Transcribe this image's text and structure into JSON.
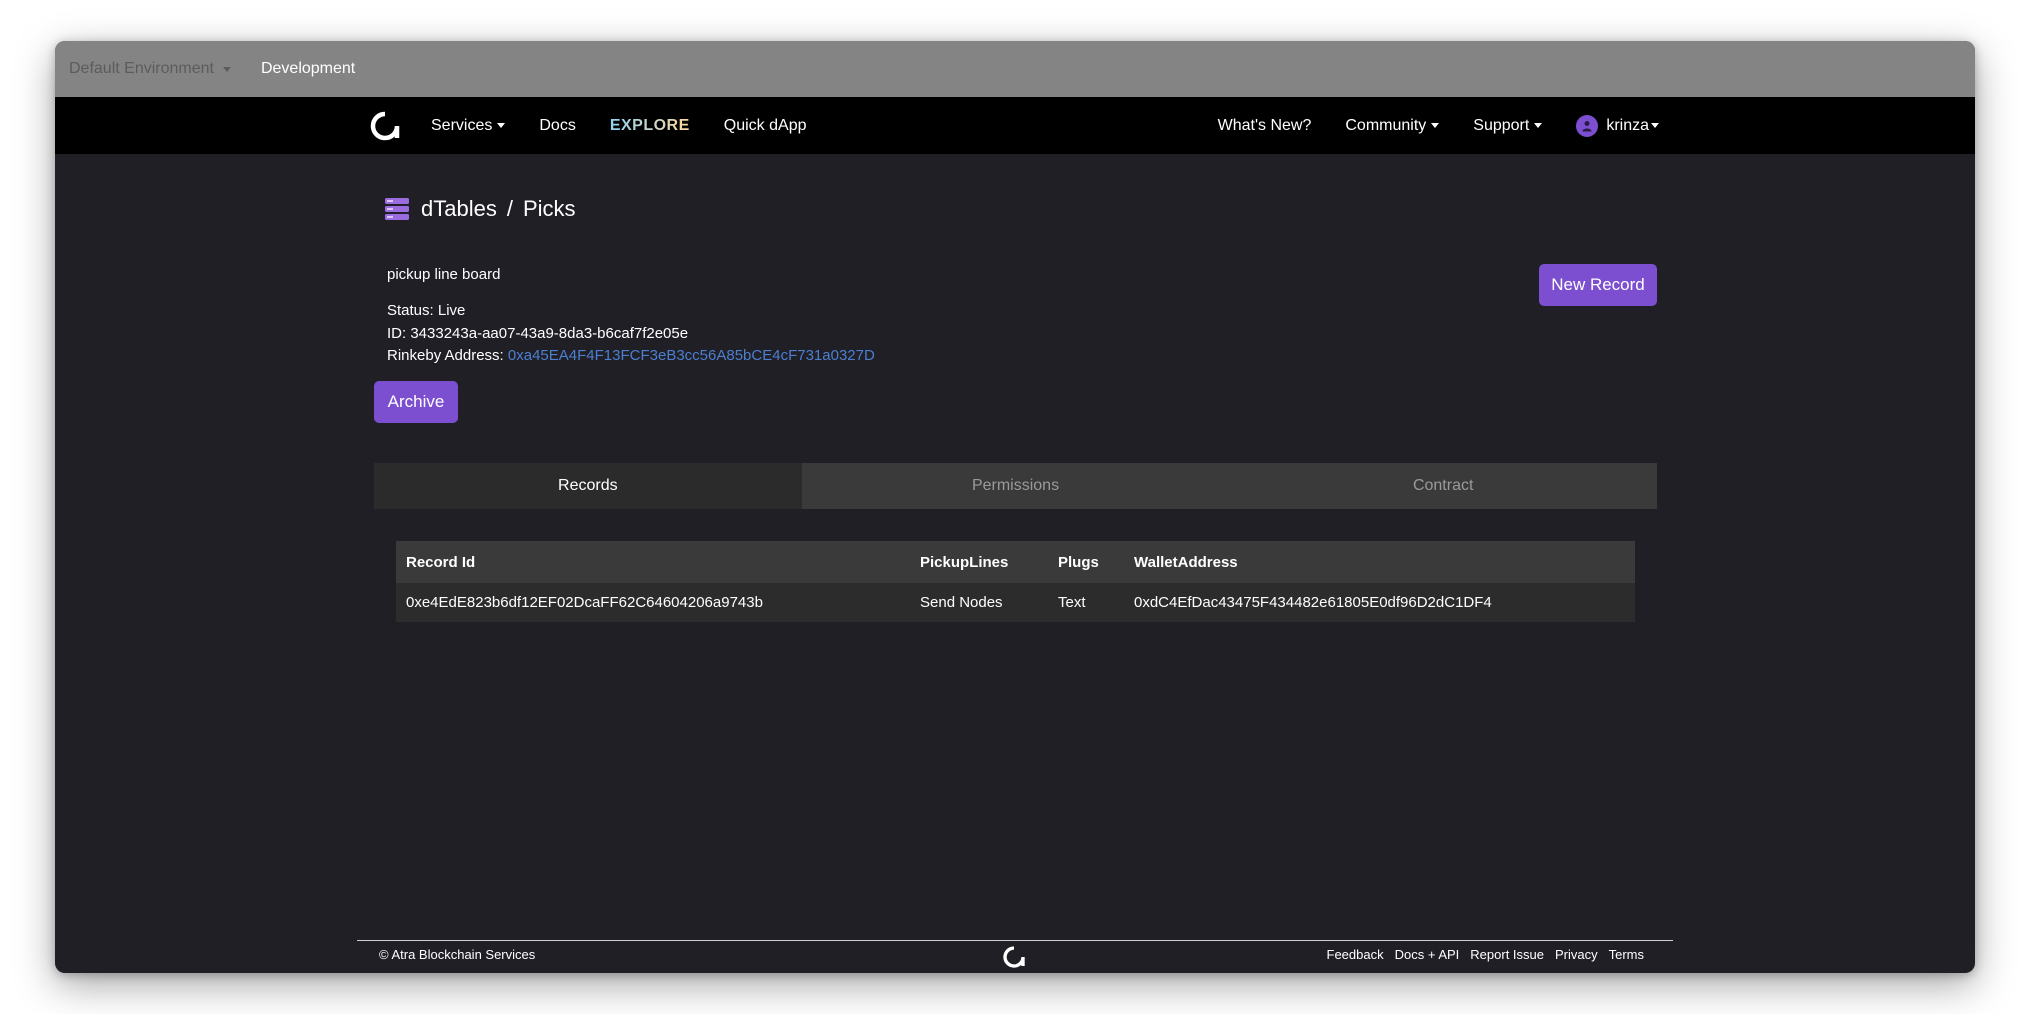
{
  "env_bar": {
    "default_env": "Default Environment",
    "current_env": "Development"
  },
  "nav": {
    "services": "Services",
    "docs": "Docs",
    "explore": "EXPLORE",
    "quick_dapp": "Quick dApp",
    "whats_new": "What's New?",
    "community": "Community",
    "support": "Support",
    "username": "krinza"
  },
  "page": {
    "breadcrumb_root": "dTables",
    "breadcrumb_sep": "/",
    "breadcrumb_current": "Picks",
    "description": "pickup line board",
    "status_label": "Status:",
    "status_value": "Live",
    "id_label": "ID:",
    "id_value": "3433243a-aa07-43a9-8da3-b6caf7f2e05e",
    "address_label": "Rinkeby Address:",
    "address_value": "0xa45EA4F4F13FCF3eB3cc56A85bCE4cF731a0327D",
    "archive_label": "Archive",
    "new_record_label": "New Record"
  },
  "tabs": [
    "Records",
    "Permissions",
    "Contract"
  ],
  "table": {
    "columns": [
      "Record Id",
      "PickupLines",
      "Plugs",
      "WalletAddress"
    ],
    "rows": [
      [
        "0xe4EdE823b6df12EF02DcaFF62C64604206a9743b",
        "Send Nodes",
        "Text",
        "0xdC4EfDac43475F434482e61805E0df96D2dC1DF4"
      ]
    ]
  },
  "footer": {
    "copyright": "© Atra Blockchain Services",
    "links": [
      "Feedback",
      "Docs + API",
      "Report Issue",
      "Privacy",
      "Terms"
    ]
  },
  "colors": {
    "accent": "#7b4fd0",
    "link": "#4c7fd0",
    "background": "#201f26"
  }
}
